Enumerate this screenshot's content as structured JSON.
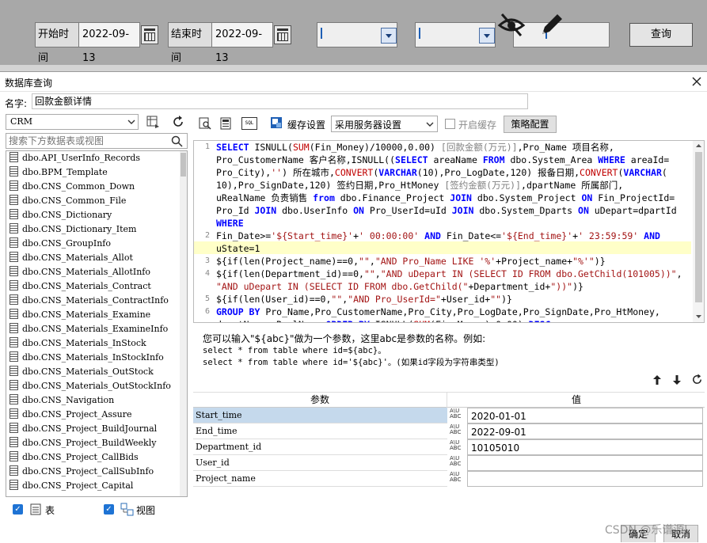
{
  "filter_bar": {
    "start_label": "开始时间",
    "start_date": "2022-09-13",
    "end_label": "结束时间",
    "end_date": "2022-09-13",
    "query_button": "查询"
  },
  "dialog": {
    "title": "数据库查询",
    "name_label": "名字:",
    "name_value": "回款金额详情"
  },
  "left_panel": {
    "db_select": "CRM",
    "search_placeholder": "搜索下方数据表或视图",
    "tables": [
      "dbo.API_UserInfo_Records",
      "dbo.BPM_Template",
      "dbo.CNS_Common_Down",
      "dbo.CNS_Common_File",
      "dbo.CNS_Dictionary",
      "dbo.CNS_Dictionary_Item",
      "dbo.CNS_GroupInfo",
      "dbo.CNS_Materials_Allot",
      "dbo.CNS_Materials_AllotInfo",
      "dbo.CNS_Materials_Contract",
      "dbo.CNS_Materials_ContractInfo",
      "dbo.CNS_Materials_Examine",
      "dbo.CNS_Materials_ExamineInfo",
      "dbo.CNS_Materials_InStock",
      "dbo.CNS_Materials_InStockInfo",
      "dbo.CNS_Materials_OutStock",
      "dbo.CNS_Materials_OutStockInfo",
      "dbo.CNS_Navigation",
      "dbo.CNS_Project_Assure",
      "dbo.CNS_Project_BuildJournal",
      "dbo.CNS_Project_BuildWeekly",
      "dbo.CNS_Project_CallBids",
      "dbo.CNS_Project_CallSubInfo",
      "dbo.CNS_Project_Capital"
    ],
    "table_checkbox_label": "表",
    "view_checkbox_label": "视图"
  },
  "toolbar": {
    "cache_settings_label": "缓存设置",
    "cache_mode_value": "采用服务器设置",
    "enable_cache_label": "开启缓存",
    "policy_button": "策略配置",
    "sql_icon_text": "SQL"
  },
  "editor": {
    "line_numbers": [
      "1",
      "2",
      "3",
      "4",
      "5",
      "6"
    ]
  },
  "hint": {
    "line1": "您可以输入\"${abc}\"做为一个参数，这里abc是参数的名称。例如:",
    "line2": "select * from table where id=${abc}。",
    "line3": "select * from table where id='${abc}'。(如果id字段为字符串类型)"
  },
  "params": {
    "header_param": "参数",
    "header_value": "值",
    "abc_icon_text": "A\\U\nABC",
    "rows": [
      {
        "name": "Start_time",
        "value": "2020-01-01"
      },
      {
        "name": "End_time",
        "value": "2022-09-01"
      },
      {
        "name": "Department_id",
        "value": "10105010"
      },
      {
        "name": "User_id",
        "value": ""
      },
      {
        "name": "Project_name",
        "value": ""
      }
    ]
  },
  "footer": {
    "ok_button": "确定",
    "cancel_button": "取消",
    "watermark": "CSDN @乐谱源l"
  },
  "colors": {
    "keyword": "#0000ff",
    "function": "#c00000",
    "highlight_line": "#ffffc8",
    "selected_row": "#c5d9ec"
  }
}
